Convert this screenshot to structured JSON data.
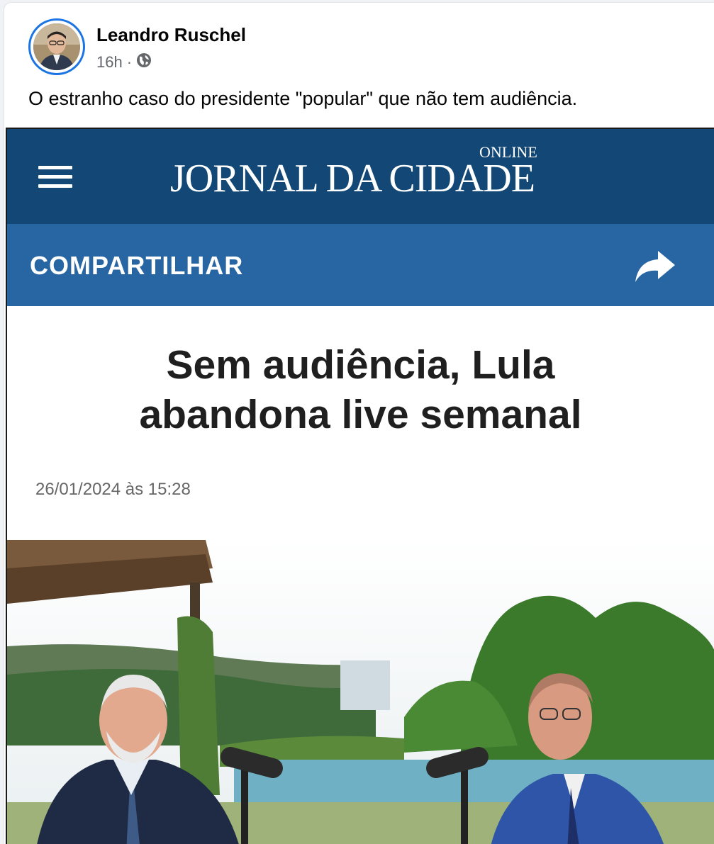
{
  "post": {
    "author": "Leandro Ruschel",
    "time": "16h",
    "separator": "·",
    "text": "O estranho caso do presidente \"popular\" que não tem audiência."
  },
  "screenshot": {
    "logo_main": "JORNAL DA CIDADE",
    "logo_sub": "ONLINE",
    "share_label": "COMPARTILHAR",
    "headline_line1": "Sem audiência, Lula",
    "headline_line2": "abandona live semanal",
    "date": "26/01/2024 às 15:28"
  },
  "colors": {
    "topbar": "#134876",
    "sharebar": "#2765a3",
    "avatar_ring": "#1b74e4"
  },
  "icons": [
    "globe-icon",
    "menu-icon",
    "share-arrow-icon"
  ]
}
